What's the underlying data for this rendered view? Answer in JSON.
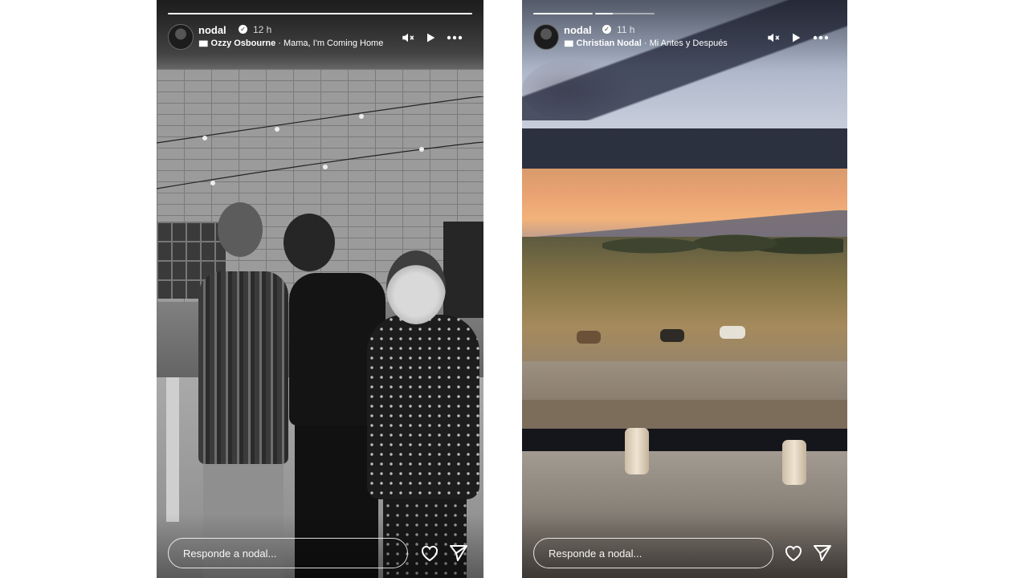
{
  "stories": [
    {
      "username": "nodal",
      "time": "12 h",
      "music": {
        "artist": "Ozzy Osbourne",
        "separator": " · ",
        "song": "Mama, I'm Coming Home"
      },
      "reply_placeholder": "Responde a nodal...",
      "progress_segments": [
        1
      ]
    },
    {
      "username": "nodal",
      "time": "11 h",
      "music": {
        "artist": "Christian Nodal",
        "separator": " · ",
        "song": "Mi Antes y Después"
      },
      "reply_placeholder": "Responde a nodal...",
      "progress_segments": [
        1,
        0.3
      ]
    }
  ],
  "icons": {
    "verified": "verified-badge-icon",
    "music": "music-bars-icon",
    "mute": "muted-speaker-icon",
    "play": "play-icon",
    "more": "more-options-icon",
    "like": "heart-icon",
    "share": "send-icon"
  }
}
